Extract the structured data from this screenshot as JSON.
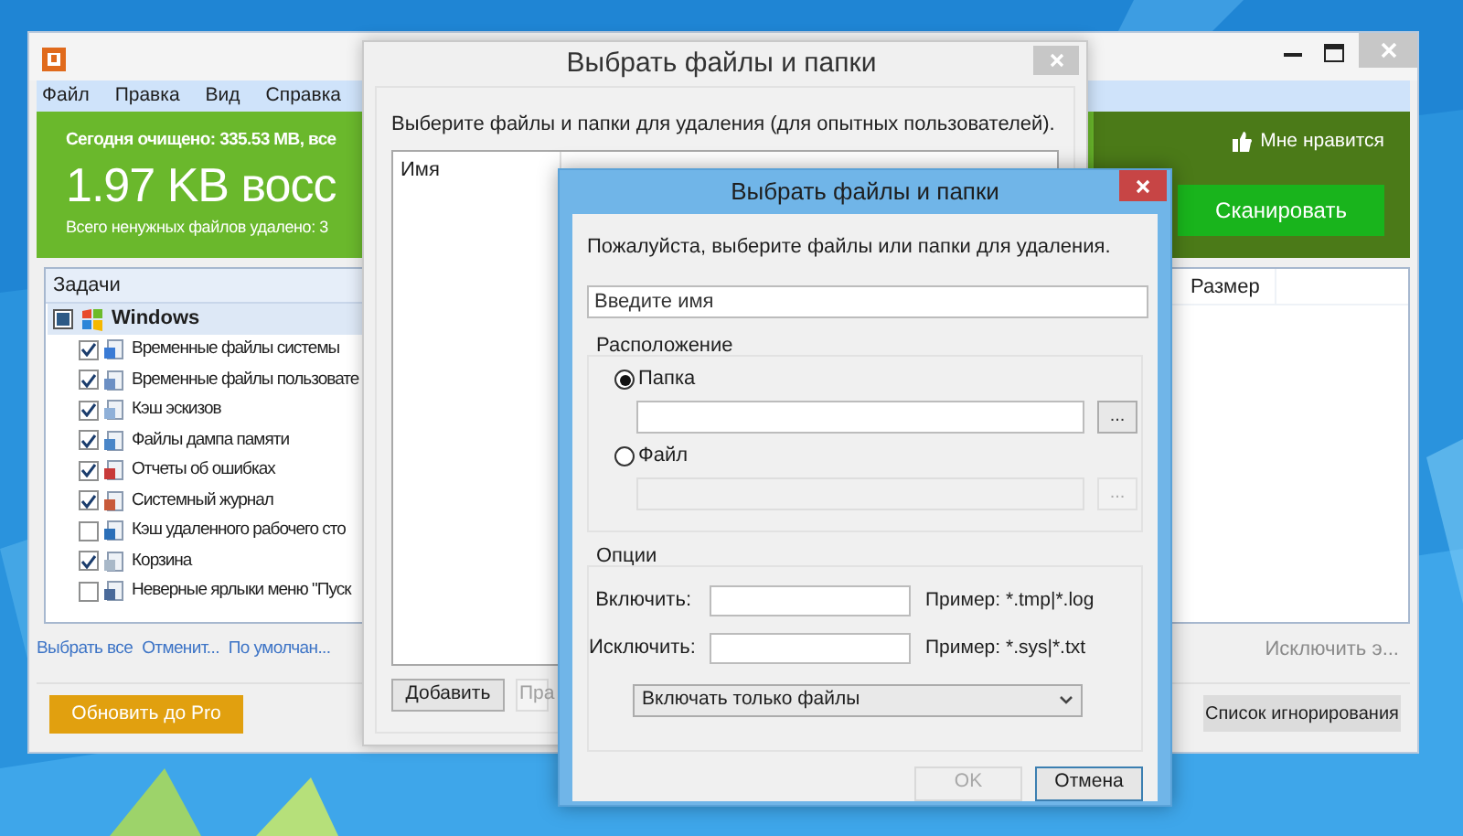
{
  "main_window": {
    "menu": [
      "Файл",
      "Правка",
      "Вид",
      "Справка"
    ],
    "banner": {
      "today": "Сегодня очищено: 335.53 MB, все",
      "recovered": "1.97 KB восс",
      "total": "Всего ненужных файлов удалено: 3",
      "like": "Мне нравится",
      "scan_button": "Сканировать"
    },
    "tasks": {
      "title": "Задачи",
      "group": {
        "label": "Windows",
        "indeterminate": true
      },
      "items": [
        {
          "label": "Временные файлы системы",
          "checked": true
        },
        {
          "label": "Временные файлы пользовате",
          "checked": true
        },
        {
          "label": "Кэш эскизов",
          "checked": true
        },
        {
          "label": "Файлы дампа памяти",
          "checked": true
        },
        {
          "label": "Отчеты об ошибках",
          "checked": true
        },
        {
          "label": "Системный журнал",
          "checked": true
        },
        {
          "label": "Кэш удаленного рабочего сто",
          "checked": false
        },
        {
          "label": "Корзина",
          "checked": true
        },
        {
          "label": "Неверные ярлыки меню \"Пуск",
          "checked": false
        }
      ]
    },
    "links": [
      "Выбрать все",
      "Отменит...",
      "По умолчан..."
    ],
    "upgrade_button": "Обновить до Pro",
    "results": {
      "columns": [
        "Размер"
      ],
      "exclude_link": "Исключить э...",
      "ignore_button": "Список игнорирования"
    }
  },
  "advanced_dialog": {
    "title": "Выбрать файлы и папки",
    "description": "Выберите файлы и папки для удаления (для опытных пользователей).",
    "columns": [
      "Имя"
    ],
    "buttons": [
      {
        "label": "Добавить",
        "disabled": false
      },
      {
        "label": "Пра",
        "disabled": true
      }
    ]
  },
  "select_dialog": {
    "title": "Выбрать файлы и папки",
    "description": "Пожалуйста, выберите файлы или папки для удаления.",
    "name_field": {
      "placeholder": "Введите имя"
    },
    "location": {
      "title": "Расположение",
      "options": [
        {
          "label": "Папка",
          "selected": true,
          "disabled": false,
          "browse": "..."
        },
        {
          "label": "Файл",
          "selected": false,
          "disabled": true,
          "browse": "..."
        }
      ]
    },
    "options": {
      "title": "Опции",
      "filters": [
        {
          "label": "Включить:",
          "example": "Пример: *.tmp|*.log"
        },
        {
          "label": "Исключить:",
          "example": "Пример: *.sys|*.txt"
        }
      ],
      "mode": "Включать только файлы"
    },
    "buttons": [
      {
        "label": "OK",
        "disabled": true
      },
      {
        "label": "Отмена",
        "disabled": false
      }
    ]
  }
}
